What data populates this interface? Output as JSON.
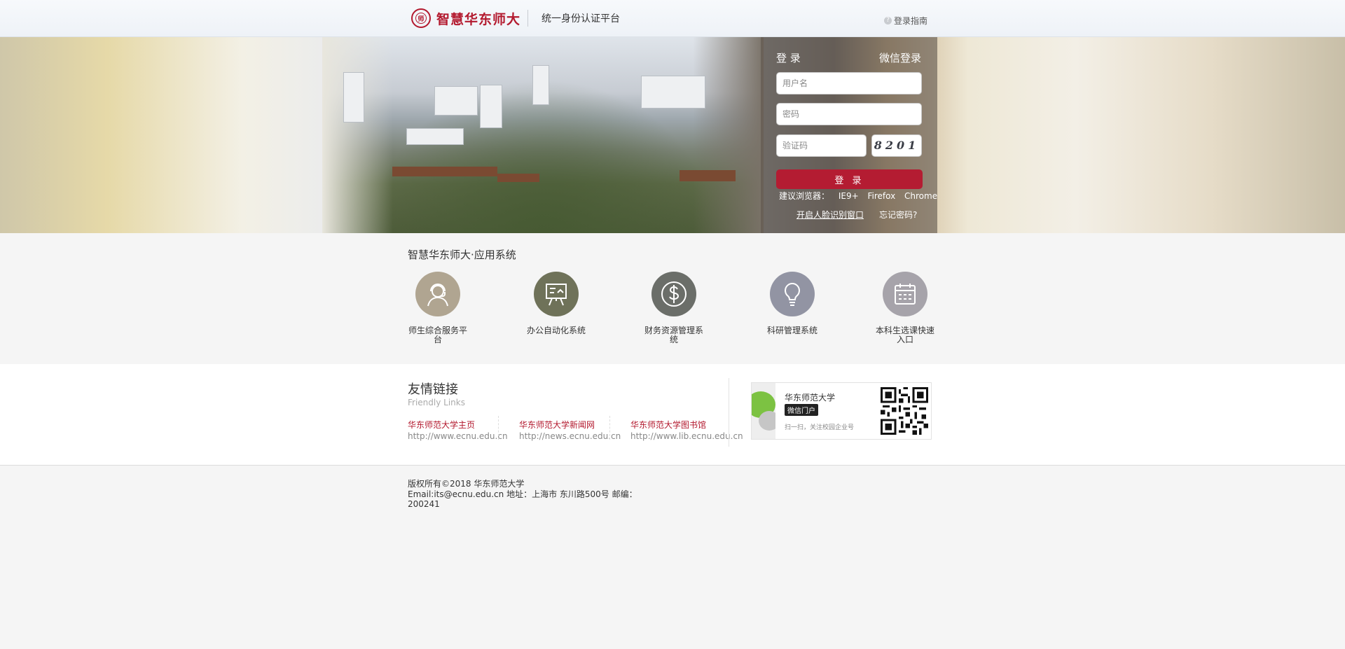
{
  "header": {
    "logo_text": "智慧华东师大",
    "logo_seal": "师",
    "platform_title": "统一身份认证平台",
    "guide_label": "登录指南"
  },
  "login": {
    "tab_login": "登 录",
    "tab_wechat": "微信登录",
    "username_placeholder": "用户名",
    "password_placeholder": "密码",
    "captcha_placeholder": "验证码",
    "captcha_code": "8201",
    "submit_label": "登 录",
    "browsers_prefix": "建议浏览器：",
    "browsers": [
      "IE9+",
      "Firefox",
      "Chrome"
    ],
    "face_window": "开启人脸识别窗口",
    "forgot": "忘记密码?"
  },
  "apps": {
    "title": "智慧华东师大·应用系统",
    "items": [
      {
        "label": "师生综合服务平台",
        "icon": "headset-person-icon",
        "color": "#b0a591"
      },
      {
        "label": "办公自动化系统",
        "icon": "presentation-board-icon",
        "color": "#6f7259"
      },
      {
        "label": "财务资源管理系统",
        "icon": "dollar-icon",
        "color": "#6b6e69"
      },
      {
        "label": "科研管理系统",
        "icon": "lightbulb-icon",
        "color": "#9294a3"
      },
      {
        "label": "本科生选课快速入口",
        "icon": "calendar-icon",
        "color": "#a6a3aa"
      }
    ]
  },
  "links": {
    "title": "友情链接",
    "subtitle": "Friendly Links",
    "items": [
      {
        "name": "华东师范大学主页",
        "url": "http://www.ecnu.edu.cn"
      },
      {
        "name": "华东师范大学新闻网",
        "url": "http://news.ecnu.edu.cn"
      },
      {
        "name": "华东师范大学图书馆",
        "url": "http://www.lib.ecnu.edu.cn"
      }
    ],
    "wechat": {
      "name": "华东师范大学",
      "badge": "微信门户",
      "desc": "扫一扫，关注校园企业号"
    }
  },
  "footer": {
    "copyright": "版权所有©2018 华东师范大学",
    "contact": "Email:its@ecnu.edu.cn    地址：上海市 东川路500号 邮编：200241"
  },
  "colors": {
    "brand": "#b3192e",
    "submit": "#b41c32"
  }
}
